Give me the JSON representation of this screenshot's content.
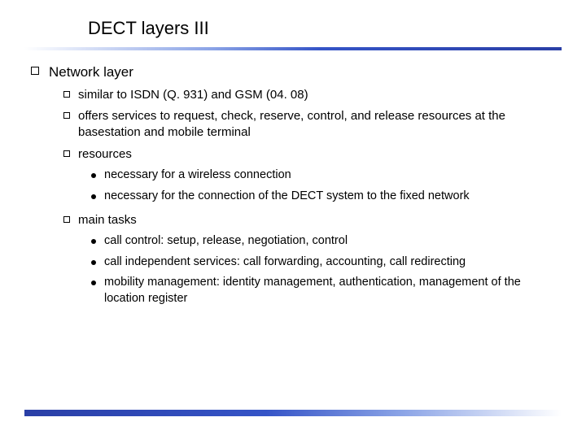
{
  "title": "DECT layers III",
  "heading": "Network layer",
  "sub": {
    "a": "similar to ISDN (Q. 931) and GSM (04. 08)",
    "b": "offers services to request, check, reserve, control, and release resources at the basestation and mobile terminal",
    "c": "resources",
    "c_items": {
      "c1": "necessary for a wireless connection",
      "c2": "necessary for the connection of the DECT system to the fixed network"
    },
    "d": "main tasks",
    "d_items": {
      "d1": "call control: setup, release, negotiation, control",
      "d2": "call independent services: call forwarding, accounting, call redirecting",
      "d3": "mobility management: identity management, authentication, management of the location register"
    }
  }
}
